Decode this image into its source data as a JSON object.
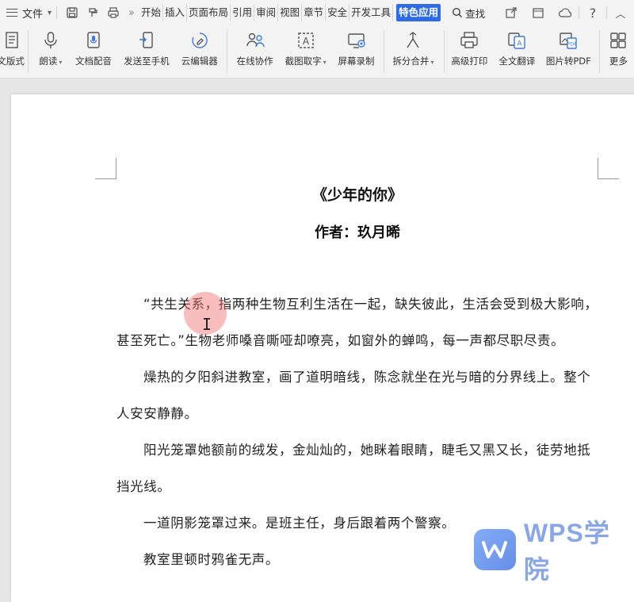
{
  "menubar": {
    "file_label": "文件",
    "more_symbol": "»",
    "tabs": [
      "开始",
      "插入",
      "页面布局",
      "引用",
      "审阅",
      "视图",
      "章节",
      "安全",
      "开发工具"
    ],
    "active_tab": "特色应用",
    "search_label": "查找"
  },
  "ribbon": {
    "items": [
      {
        "label": "文版式",
        "icon": "document-layout-icon"
      },
      {
        "label": "朗读",
        "icon": "microphone-icon",
        "dropdown": true
      },
      {
        "label": "文档配音",
        "icon": "voice-dub-icon"
      },
      {
        "label": "发送至手机",
        "icon": "send-to-phone-icon"
      },
      {
        "label": "云编辑器",
        "icon": "cloud-editor-icon"
      },
      {
        "label": "在线协作",
        "icon": "collaboration-icon"
      },
      {
        "label": "截图取字",
        "icon": "screenshot-text-icon",
        "dropdown": true
      },
      {
        "label": "屏幕录制",
        "icon": "screen-record-icon"
      },
      {
        "label": "拆分合并",
        "icon": "split-merge-icon",
        "dropdown": true
      },
      {
        "label": "高级打印",
        "icon": "printer-icon"
      },
      {
        "label": "全文翻译",
        "icon": "translate-icon"
      },
      {
        "label": "图片转PDF",
        "icon": "image-to-pdf-icon"
      },
      {
        "label": "更多",
        "icon": "more-icon"
      }
    ]
  },
  "document": {
    "title": "《少年的你》",
    "author": "作者：玖月晞",
    "paragraphs": [
      "“共生关系，指两种生物互利生活在一起，缺失彼此，生活会受到极大影响，甚至死亡。”生物老师嗓音嘶哑却嘹亮，如窗外的蝉鸣，每一声都尽职尽责。",
      "燥热的夕阳斜进教室，画了道明暗线，陈念就坐在光与暗的分界线上。整个人安安静静。",
      "阳光笼罩她额前的绒发，金灿灿的，她眯着眼睛，睫毛又黑又长，徒劳地抵挡光线。",
      "一道阴影笼罩过来。是班主任，身后跟着两个警察。",
      "教室里顿时鸦雀无声。"
    ]
  },
  "watermark": {
    "text": "WPS学院"
  },
  "colors": {
    "accent": "#2e6be6",
    "watermark": "#7f9fe6"
  }
}
